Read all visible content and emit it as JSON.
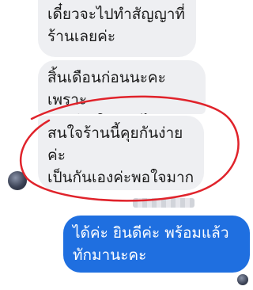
{
  "messages": [
    {
      "from": "them",
      "text": "เดี๋ยวจะไปทำสัญญาที่\nร้านเลยค่ะ"
    },
    {
      "from": "them",
      "text": "สิ้นเดือนก่อนนะคะเพราะ\nอยู่เชียงใหม่ค่ะไกลมาก"
    },
    {
      "from": "them",
      "text": "สนใจร้านนี้คุยกันง่ายค่ะ\nเป็นกันเองค่ะพอใจมาก\nเลย"
    },
    {
      "from": "me",
      "text": "ได้ค่ะ ยินดีค่ะ พร้อมแล้ว\nทักมานะคะ"
    }
  ],
  "colors": {
    "incoming_bubble": "#eeeff2",
    "outgoing_bubble": "#1f6fe0",
    "annotation": "#e0232b"
  },
  "icons": {
    "sender_avatar": "avatar",
    "read_receipt": "seen-avatar-icon"
  }
}
